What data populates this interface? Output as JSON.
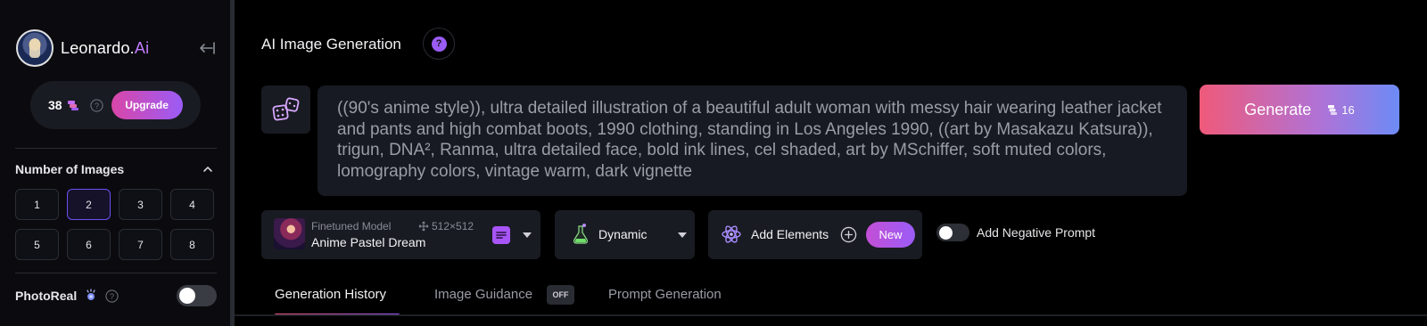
{
  "sidebar": {
    "brand_name": "Leonardo.",
    "brand_suffix": "Ai",
    "credits": "38",
    "upgrade_label": "Upgrade",
    "number_of_images_title": "Number of Images",
    "number_options": [
      "1",
      "2",
      "3",
      "4",
      "5",
      "6",
      "7",
      "8"
    ],
    "selected_number": "2",
    "photoreal_label": "PhotoReal",
    "photoreal_enabled": false
  },
  "main": {
    "page_title": "AI Image Generation",
    "help_glyph": "?",
    "prompt": "((90's anime style)), ultra detailed illustration of a beautiful adult woman with messy hair wearing leather jacket and pants and high combat boots, 1990 clothing, standing in Los Angeles 1990, ((art by Masakazu Katsura)), trigun, DNA², Ranma, ultra detailed face, bold ink lines, cel shaded, art by MSchiffer, soft muted colors, lomography colors, vintage warm, dark vignette",
    "generate_label": "Generate",
    "generate_cost": "16",
    "model": {
      "sub_label": "Finetuned Model",
      "dimensions": "512×512",
      "name": "Anime Pastel Dream"
    },
    "style_label": "Dynamic",
    "elements_label": "Add Elements",
    "new_badge": "New",
    "negative_prompt_label": "Add Negative Prompt",
    "negative_prompt_enabled": false,
    "tabs": [
      {
        "label": "Generation History",
        "active": true
      },
      {
        "label": "Image Guidance",
        "badge": "OFF",
        "active": false
      },
      {
        "label": "Prompt Generation",
        "active": false
      }
    ]
  },
  "colors": {
    "accent_purple": "#9b5cf6",
    "accent_pink": "#d946a8",
    "generate_gradient_start": "#ef5a7a",
    "generate_gradient_end": "#6d8bf6",
    "background": "#000000",
    "panel": "#191b22"
  }
}
